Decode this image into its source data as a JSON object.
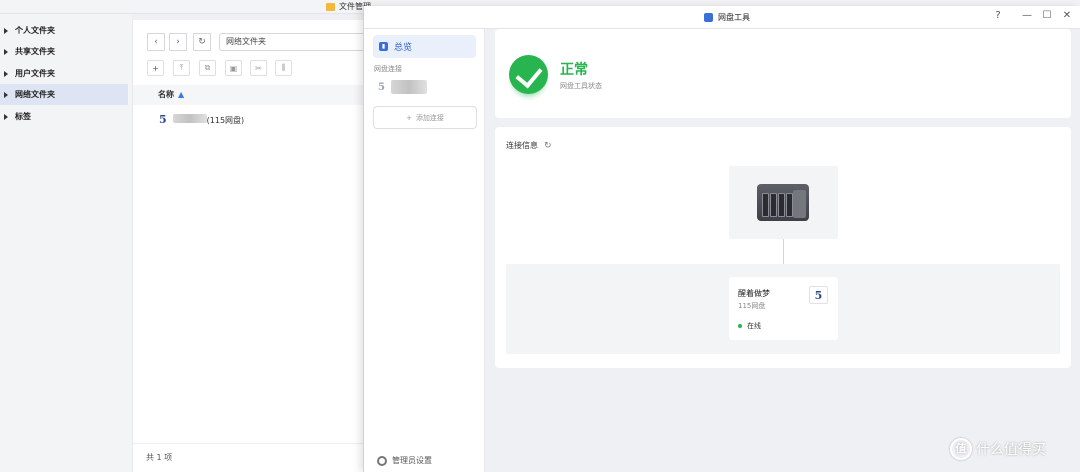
{
  "file_manager": {
    "title": "文件管理",
    "sidebar": {
      "items": [
        {
          "label": "个人文件夹"
        },
        {
          "label": "共享文件夹"
        },
        {
          "label": "用户文件夹"
        },
        {
          "label": "网络文件夹",
          "active": true
        },
        {
          "label": "标签"
        }
      ]
    },
    "path": "网络文件夹",
    "column_name": "名称",
    "files": [
      {
        "icon": "5",
        "name_suffix": "(115网盘)"
      }
    ],
    "footer": "共 1 项"
  },
  "window": {
    "title": "网盘工具",
    "controls": {
      "help": "?",
      "minimize": "—",
      "maximize": "☐",
      "close": "✕"
    },
    "sidebar": {
      "overview": "总览",
      "section_label": "网盘连接",
      "connection_icon": "5",
      "add_connection": "添加连接",
      "admin_settings": "管理员设置"
    },
    "status": {
      "value": "正常",
      "label": "网盘工具状态",
      "color": "#28b44f"
    },
    "connection": {
      "title": "连接信息",
      "cloud": {
        "name": "醒着做梦",
        "provider": "115网盘",
        "logo": "5",
        "status": "在线"
      }
    }
  },
  "watermark": {
    "logo": "值",
    "text": "什么值得买"
  }
}
